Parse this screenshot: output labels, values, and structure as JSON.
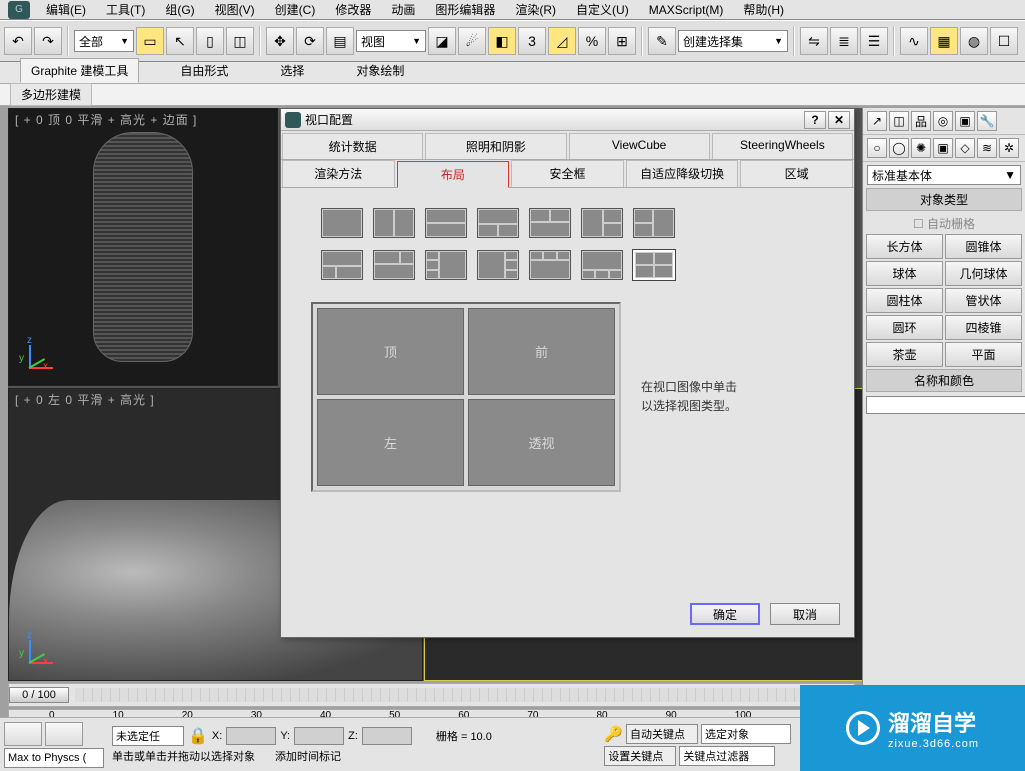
{
  "menu": {
    "items": [
      "编辑(E)",
      "工具(T)",
      "组(G)",
      "视图(V)",
      "创建(C)",
      "修改器",
      "动画",
      "图形编辑器",
      "渲染(R)",
      "自定义(U)",
      "MAXScript(M)",
      "帮助(H)"
    ]
  },
  "toolbar": {
    "scope_combo": "全部",
    "view_combo": "视图",
    "selset_combo": "创建选择集"
  },
  "ribbon": {
    "tabs": [
      "Graphite 建模工具",
      "自由形式",
      "选择",
      "对象绘制"
    ],
    "sub_tab": "多边形建模"
  },
  "viewports": {
    "top_left": "[ + 0 顶 0 平滑 + 高光 + 边面 ]",
    "bottom_left": "[ + 0 左 0 平滑 + 高光 ]"
  },
  "panel": {
    "category": "标准基本体",
    "section_objtype": "对象类型",
    "autogrid": "自动栅格",
    "buttons": [
      "长方体",
      "圆锥体",
      "球体",
      "几何球体",
      "圆柱体",
      "管状体",
      "圆环",
      "四棱锥",
      "茶壶",
      "平面"
    ],
    "section_name": "名称和颜色"
  },
  "dialog": {
    "title": "视口配置",
    "tabs_row1": [
      "统计数据",
      "照明和阴影",
      "ViewCube",
      "SteeringWheels"
    ],
    "tabs_row2": [
      "渲染方法",
      "布局",
      "安全框",
      "自适应降级切换",
      "区域"
    ],
    "preview": [
      "顶",
      "前",
      "左",
      "透视"
    ],
    "hint1": "在视口图像中单击",
    "hint2": "以选择视图类型。",
    "ok": "确定",
    "cancel": "取消"
  },
  "timeline": {
    "frame": "0 / 100",
    "ticks": [
      "0",
      "10",
      "20",
      "30",
      "40",
      "50",
      "60",
      "70",
      "80",
      "90",
      "100"
    ]
  },
  "bottom": {
    "combo1": "未选定任",
    "x": "X:",
    "y": "Y:",
    "z": "Z:",
    "grid": "栅格 = 10.0",
    "autokey": "自动关键点",
    "setkey": "设置关键点",
    "selobj": "选定对象",
    "keyfilter": "关键点过滤器",
    "status1": "单击或单击并拖动以选择对象",
    "status2": "添加时间标记",
    "physics": "Max to Physcs ("
  },
  "watermark": {
    "cn": "溜溜自学",
    "url": "zixue.3d66.com"
  }
}
